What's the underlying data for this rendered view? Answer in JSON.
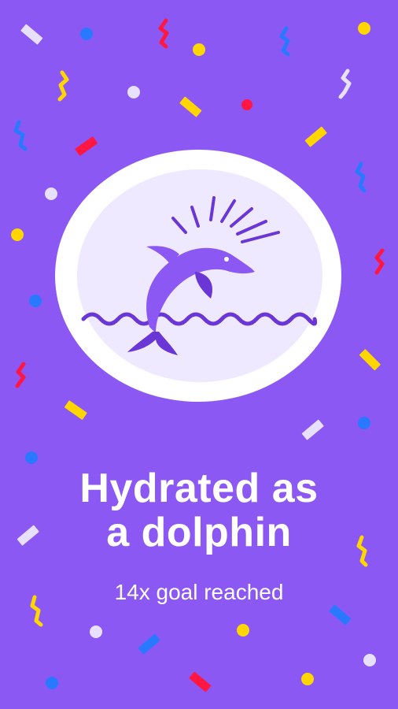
{
  "achievement": {
    "title_line1": "Hydrated as",
    "title_line2": "a dolphin",
    "subtitle": "14x goal reached"
  },
  "illustration": {
    "icon": "dolphin-icon"
  },
  "colors": {
    "background": "#8c58f4",
    "dolphin": "#8c58f4",
    "dolphin_dark": "#6a37d6",
    "waves": "#6a37d6",
    "badge_circle": "#efe9ff",
    "confetti": [
      "#ffd600",
      "#ff1744",
      "#2979ff",
      "#e8e0ff"
    ]
  }
}
